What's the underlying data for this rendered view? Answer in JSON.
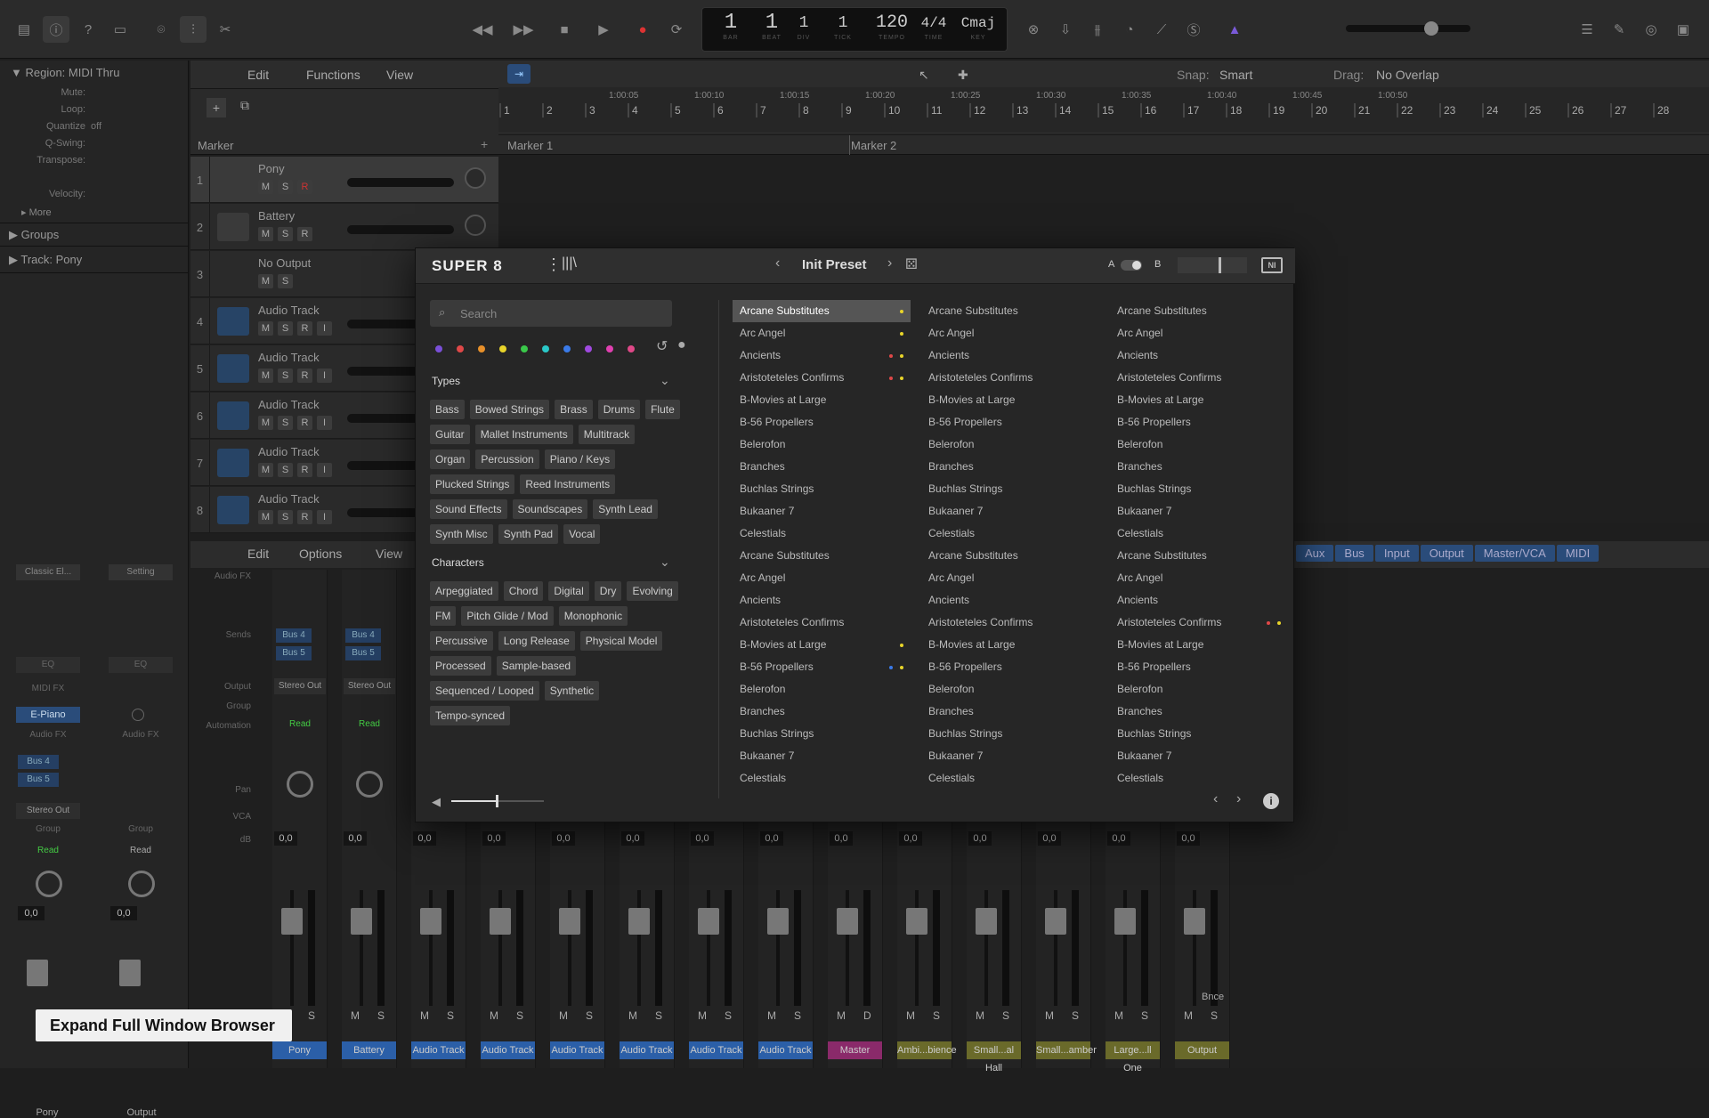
{
  "transport": {
    "bar": "1",
    "beat": "1",
    "div": "1",
    "tick": "1",
    "tempo": "120",
    "sig": "4/4",
    "key": "Cmaj",
    "lbl_bar": "BAR",
    "lbl_beat": "BEAT",
    "lbl_div": "DIV",
    "lbl_tick": "TICK",
    "lbl_tempo": "TEMPO",
    "lbl_time": "TIME",
    "lbl_key": "KEY"
  },
  "inspector": {
    "region": "Region: MIDI Thru",
    "rows": [
      "Mute:",
      "Loop:",
      "Quantize",
      "Q-Swing:",
      "Transpose:",
      "Velocity:"
    ],
    "quantize_val": "off",
    "more": "More",
    "groups": "Groups",
    "track": "Track:",
    "track_name": "Pony",
    "strips": {
      "setting_a": "Classic El...",
      "setting_b": "Setting",
      "eq_a": "EQ",
      "eq_b": "EQ",
      "midifx": "MIDI FX",
      "instrument": "E-Piano",
      "audiofx_a": "Audio FX",
      "audiofx_b": "Audio FX",
      "bus4": "Bus 4",
      "bus5": "Bus 5",
      "output": "Stereo Out",
      "group_a": "Group",
      "group_b": "Group",
      "read_a": "Read",
      "read_b": "Read",
      "db_a": "0,0",
      "db_b": "0,0",
      "name_a": "Pony",
      "name_b": "Output"
    }
  },
  "tracks_menu": {
    "edit": "Edit",
    "functions": "Functions",
    "view": "View",
    "snap": "Snap:",
    "snap_val": "Smart",
    "drag": "Drag:",
    "drag_val": "No Overlap",
    "marker": "Marker"
  },
  "ruler": {
    "bars": [
      "1",
      "2",
      "3",
      "4",
      "5",
      "6",
      "7",
      "8",
      "9",
      "10",
      "11",
      "12",
      "13",
      "14",
      "15",
      "16",
      "17",
      "18",
      "19",
      "20",
      "21",
      "22",
      "23",
      "24",
      "25",
      "26",
      "27",
      "28"
    ],
    "times": [
      "1:00:05",
      "1:00:10",
      "1:00:15",
      "1:00:20",
      "1:00:25",
      "1:00:30",
      "1:00:35",
      "1:00:40",
      "1:00:45",
      "1:00:50"
    ],
    "marker1": "Marker 1",
    "marker2": "Marker 2"
  },
  "tracks": [
    {
      "num": "1",
      "name": "Pony",
      "type": "inst"
    },
    {
      "num": "2",
      "name": "Battery",
      "type": "inst"
    },
    {
      "num": "3",
      "name": "No Output",
      "type": "none"
    },
    {
      "num": "4",
      "name": "Audio Track",
      "type": "audio"
    },
    {
      "num": "5",
      "name": "Audio Track",
      "type": "audio"
    },
    {
      "num": "6",
      "name": "Audio Track",
      "type": "audio"
    },
    {
      "num": "7",
      "name": "Audio Track",
      "type": "audio"
    },
    {
      "num": "8",
      "name": "Audio Track",
      "type": "audio"
    }
  ],
  "btn": {
    "m": "M",
    "s": "S",
    "r": "R",
    "i": "I",
    "d": "D",
    "bnce": "Bnce"
  },
  "mixer_menu": {
    "edit": "Edit",
    "options": "Options",
    "view": "View",
    "filters": [
      "Aux",
      "Bus",
      "Input",
      "Output",
      "Master/VCA",
      "MIDI"
    ],
    "labels": {
      "audiofx": "Audio FX",
      "sends": "Sends",
      "output": "Output",
      "group": "Group",
      "automation": "Automation",
      "pan": "Pan",
      "vca": "VCA",
      "db": "dB"
    }
  },
  "mixer_strips": [
    {
      "name": "Pony",
      "color": "#2b5fa8",
      "sends": [
        "Bus 4",
        "Bus 5"
      ],
      "output": "Stereo Out",
      "auto": "Read",
      "db": "0,0"
    },
    {
      "name": "Battery",
      "color": "#2b5fa8",
      "sends": [
        "Bus 4",
        "Bus 5"
      ],
      "output": "Stereo Out",
      "auto": "Read",
      "db": "0,0"
    },
    {
      "name": "Audio Track",
      "color": "#2b5fa8",
      "db": "0,0"
    },
    {
      "name": "Audio Track",
      "color": "#2b5fa8",
      "db": "0,0"
    },
    {
      "name": "Audio Track",
      "color": "#2b5fa8",
      "db": "0,0"
    },
    {
      "name": "Audio Track",
      "color": "#2b5fa8",
      "db": "0,0"
    },
    {
      "name": "Audio Track",
      "color": "#2b5fa8",
      "db": "0,0"
    },
    {
      "name": "Audio Track",
      "color": "#2b5fa8",
      "db": "0,0"
    },
    {
      "name": "Master",
      "color": "#8a2a6a",
      "db": "0,0"
    },
    {
      "name": "Ambi...bience",
      "color": "#6a6a2a",
      "db": "0,0"
    },
    {
      "name": "Small...al Hall",
      "color": "#6a6a2a",
      "db": "0,0"
    },
    {
      "name": "Small...amber",
      "color": "#6a6a2a",
      "db": "0,0"
    },
    {
      "name": "Large...ll One",
      "color": "#6a6a2a",
      "db": "0,0"
    },
    {
      "name": "Output",
      "color": "#6a6a2a",
      "db": "0,0"
    }
  ],
  "plugin": {
    "brand": "SUPER 8",
    "preset": "Init Preset",
    "ab_a": "A",
    "ab_b": "B",
    "search_placeholder": "Search",
    "colors": [
      "#7a4fd8",
      "#e04848",
      "#e8902a",
      "#e8d42a",
      "#3ac84a",
      "#2ac8c8",
      "#3a7ae8",
      "#a04ae0",
      "#e040b0",
      "#e04888"
    ],
    "types_title": "Types",
    "types": [
      [
        "Bass",
        "Bowed Strings",
        "Brass",
        "Drums",
        "Flute"
      ],
      [
        "Guitar",
        "Mallet Instruments",
        "Multitrack"
      ],
      [
        "Organ",
        "Percussion",
        "Piano / Keys"
      ],
      [
        "Plucked Strings",
        "Reed Instruments"
      ],
      [
        "Sound Effects",
        "Soundscapes",
        "Synth Lead"
      ],
      [
        "Synth Misc",
        "Synth Pad",
        "Vocal"
      ]
    ],
    "chars_title": "Characters",
    "chars": [
      [
        "Arpeggiated",
        "Chord",
        "Digital",
        "Dry",
        "Evolving"
      ],
      [
        "FM",
        "Pitch Glide / Mod",
        "Monophonic"
      ],
      [
        "Percussive",
        "Long Release",
        "Physical Model"
      ],
      [
        "Processed",
        "Sample-based"
      ],
      [
        "Sequenced / Looped",
        "Synthetic"
      ],
      [
        "Tempo-synced"
      ]
    ],
    "presets": [
      "Arcane Substitutes",
      "Arc Angel",
      "Ancients",
      "Aristoteteles Confirms",
      "B-Movies at Large",
      "B-56 Propellers",
      "Belerofon",
      "Branches",
      "Buchlas Strings",
      "Bukaaner 7",
      "Celestials",
      "Arcane Substitutes",
      "Arc Angel",
      "Ancients",
      "Aristoteteles Confirms",
      "B-Movies at Large",
      "B-56 Propellers",
      "Belerofon",
      "Branches",
      "Buchlas Strings",
      "Bukaaner 7",
      "Celestials"
    ]
  },
  "tooltip": "Expand Full Window Browser"
}
